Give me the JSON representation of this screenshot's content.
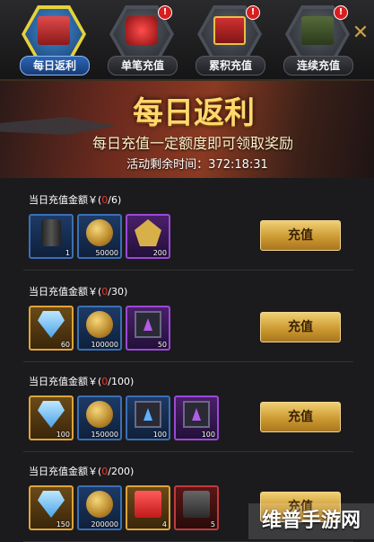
{
  "tabs": [
    {
      "label": "每日返利",
      "active": true,
      "badge": ""
    },
    {
      "label": "单笔充值",
      "active": false,
      "badge": "!"
    },
    {
      "label": "累积充值",
      "active": false,
      "badge": "!"
    },
    {
      "label": "连续充值",
      "active": false,
      "badge": "!"
    }
  ],
  "banner": {
    "title": "每日返利",
    "subtitle": "每日充值一定额度即可领取奖励",
    "time_label": "活动剩余时间：",
    "time_value": "372:18:31"
  },
  "rows": [
    {
      "prefix": "当日充值金额￥(",
      "progress": "0",
      "target": "/6)",
      "button": "充值",
      "items": [
        {
          "icon": "barrel-icon",
          "count": "1"
        },
        {
          "icon": "coin-icon",
          "count": "50000"
        },
        {
          "icon": "emblem-icon",
          "count": "200"
        }
      ]
    },
    {
      "prefix": "当日充值金额￥(",
      "progress": "0",
      "target": "/30)",
      "button": "充值",
      "items": [
        {
          "icon": "gem-icon",
          "count": "60"
        },
        {
          "icon": "coin-icon",
          "count": "100000"
        },
        {
          "icon": "chip-purple-icon",
          "count": "50"
        }
      ]
    },
    {
      "prefix": "当日充值金额￥(",
      "progress": "0",
      "target": "/100)",
      "button": "充值",
      "items": [
        {
          "icon": "gem-icon",
          "count": "100"
        },
        {
          "icon": "coin-icon",
          "count": "150000"
        },
        {
          "icon": "chip-blue-icon",
          "count": "100"
        },
        {
          "icon": "chip-purple-icon",
          "count": "100"
        }
      ]
    },
    {
      "prefix": "当日充值金额￥(",
      "progress": "0",
      "target": "/200)",
      "button": "充值",
      "items": [
        {
          "icon": "gem-icon",
          "count": "150"
        },
        {
          "icon": "coin-icon",
          "count": "200000"
        },
        {
          "icon": "gift-box-icon",
          "count": "4"
        },
        {
          "icon": "case-icon",
          "count": "5"
        }
      ]
    }
  ],
  "close_icon": "close-icon",
  "watermark": "维普手游网"
}
